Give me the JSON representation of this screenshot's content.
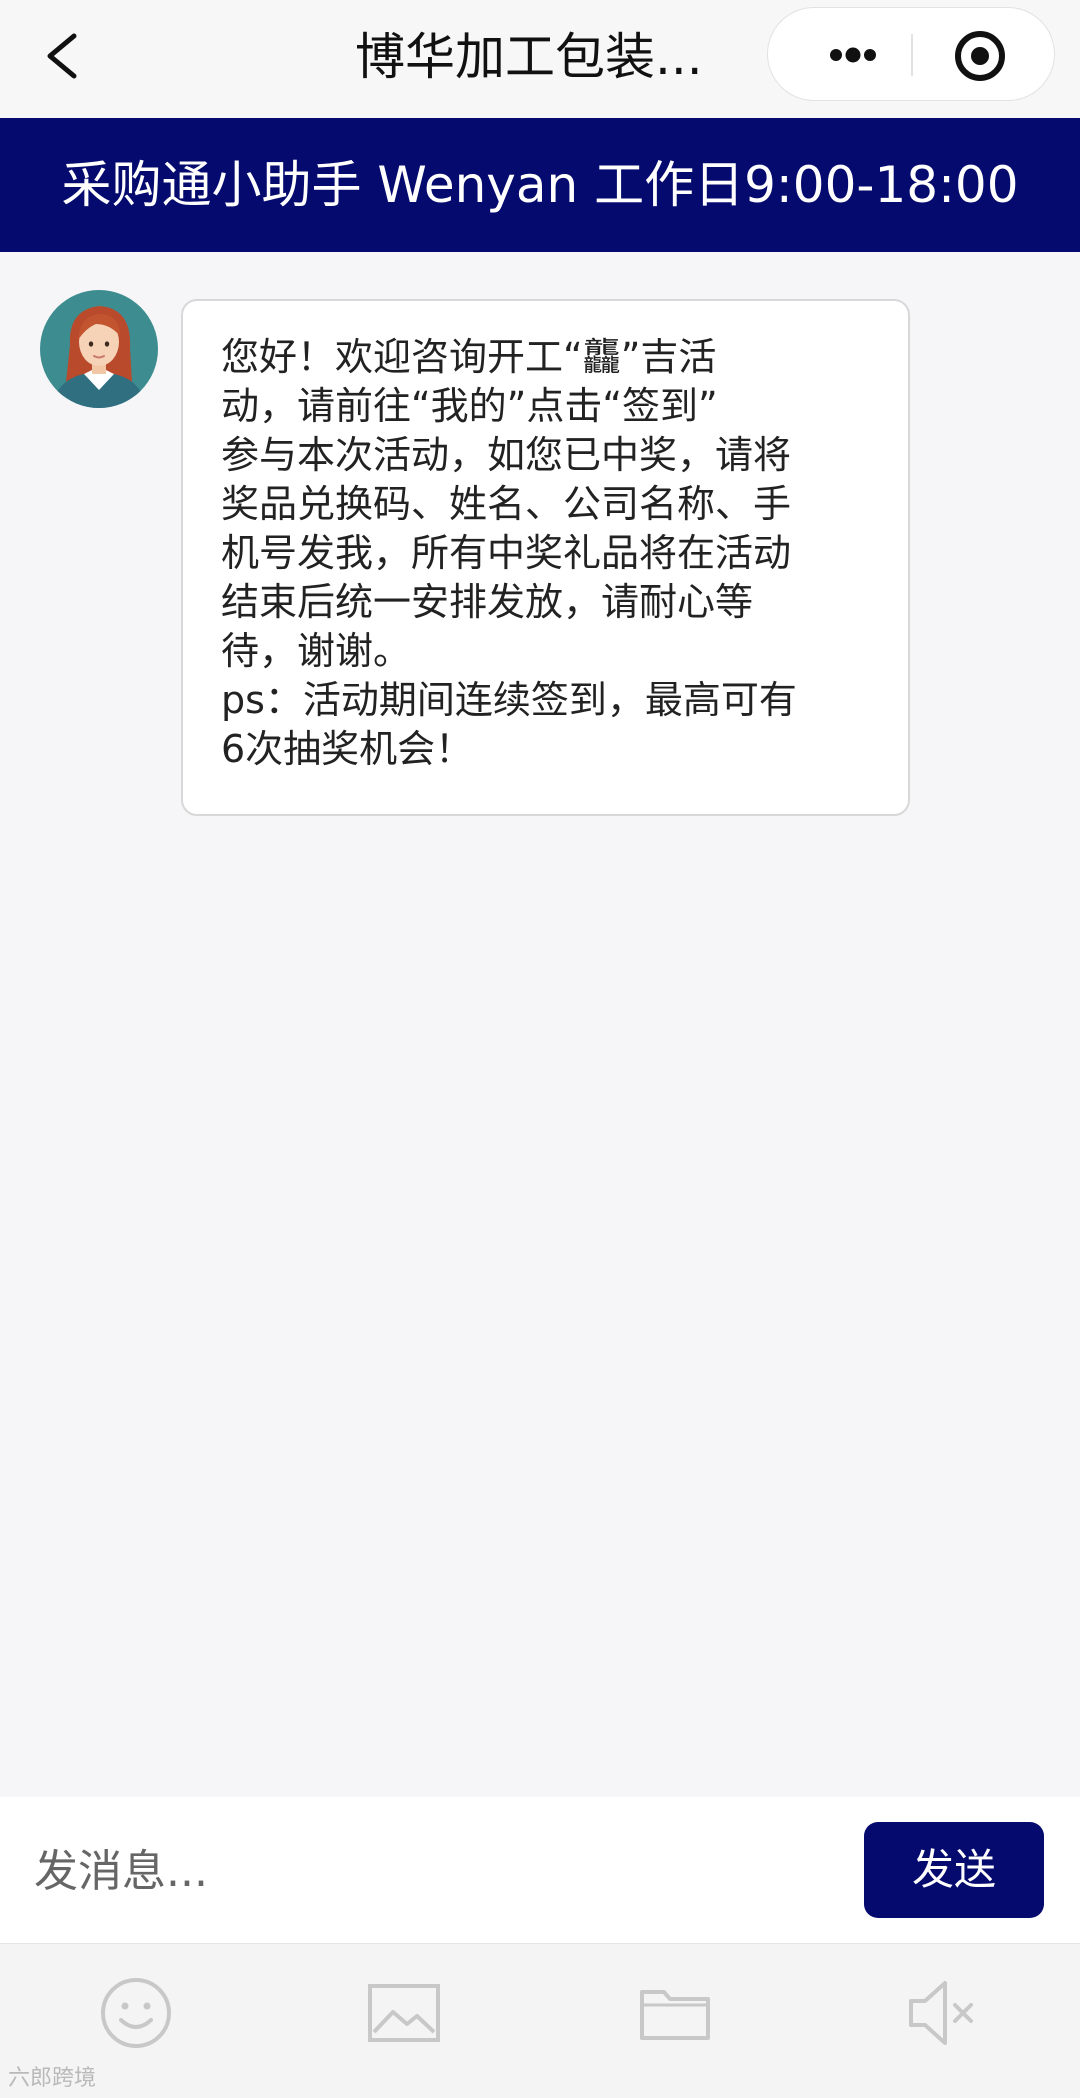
{
  "nav": {
    "title": "博华加工包装...",
    "back_icon": "chevron-left-icon",
    "more_icon": "more-dots-icon",
    "close_icon": "target-close-icon"
  },
  "banner": {
    "text": "采购通小助手 Wenyan 工作日9:00-18:00"
  },
  "chat": {
    "messages": [
      {
        "sender": "assistant",
        "avatar_icon": "female-avatar-icon",
        "text": "您好！欢迎咨询开工“龘”吉活\n动，请前往“我的”点击“签到”\n参与本次活动，如您已中奖，请将\n奖品兑换码、姓名、公司名称、手\n机号发我，所有中奖礼品将在活动\n结束后统一安排发放，请耐心等\n待，谢谢。\nps：活动期间连续签到，最高可有\n6次抽奖机会！"
      }
    ]
  },
  "composer": {
    "placeholder": "发消息...",
    "send_label": "发送"
  },
  "toolbar": {
    "items": [
      {
        "icon": "emoji-icon"
      },
      {
        "icon": "image-icon"
      },
      {
        "icon": "folder-icon"
      },
      {
        "icon": "speaker-mute-icon"
      }
    ]
  },
  "watermark": {
    "text": "六郎跨境"
  },
  "colors": {
    "brand": "#050a6e",
    "background": "#f6f6f8"
  }
}
